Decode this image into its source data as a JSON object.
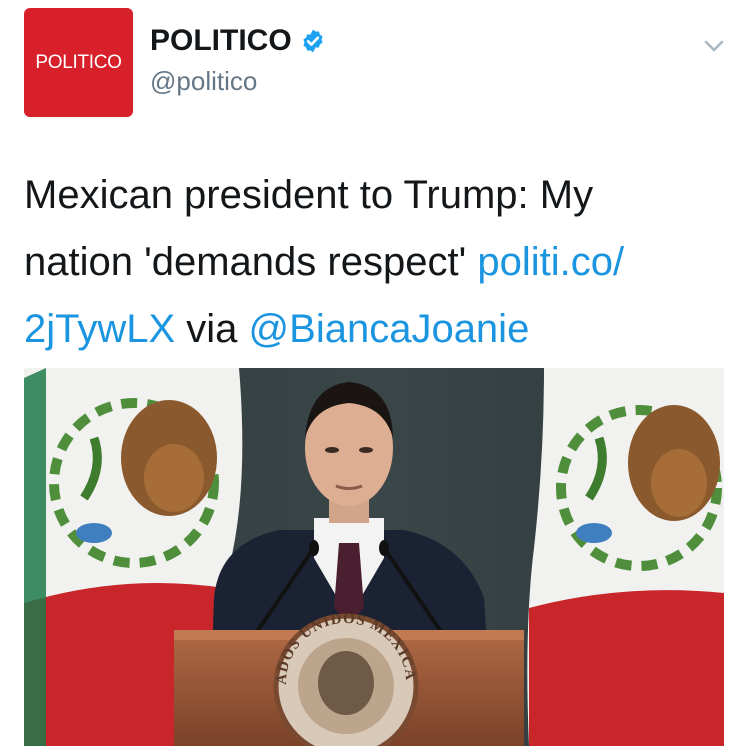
{
  "account": {
    "avatar_text": "POLITICO",
    "display_name": "POLITICO",
    "handle": "@politico",
    "verified": true
  },
  "tweet": {
    "text_line1": "Mexican president to Trump: My",
    "text_line2_prefix": "nation 'demands respect' ",
    "link_part1": "politi.co/",
    "link_part2": "2jTywLX",
    "via_text": " via ",
    "mention": "@BiancaJoanie"
  },
  "media": {
    "seal_text": "ESTADOS UNIDOS MEXICANOS"
  },
  "colors": {
    "brand_red": "#d7202a",
    "link_blue": "#1b95e0",
    "verified_blue": "#1da1f2"
  },
  "icons": {
    "verified": "verified-badge-icon",
    "menu": "chevron-down-icon"
  }
}
